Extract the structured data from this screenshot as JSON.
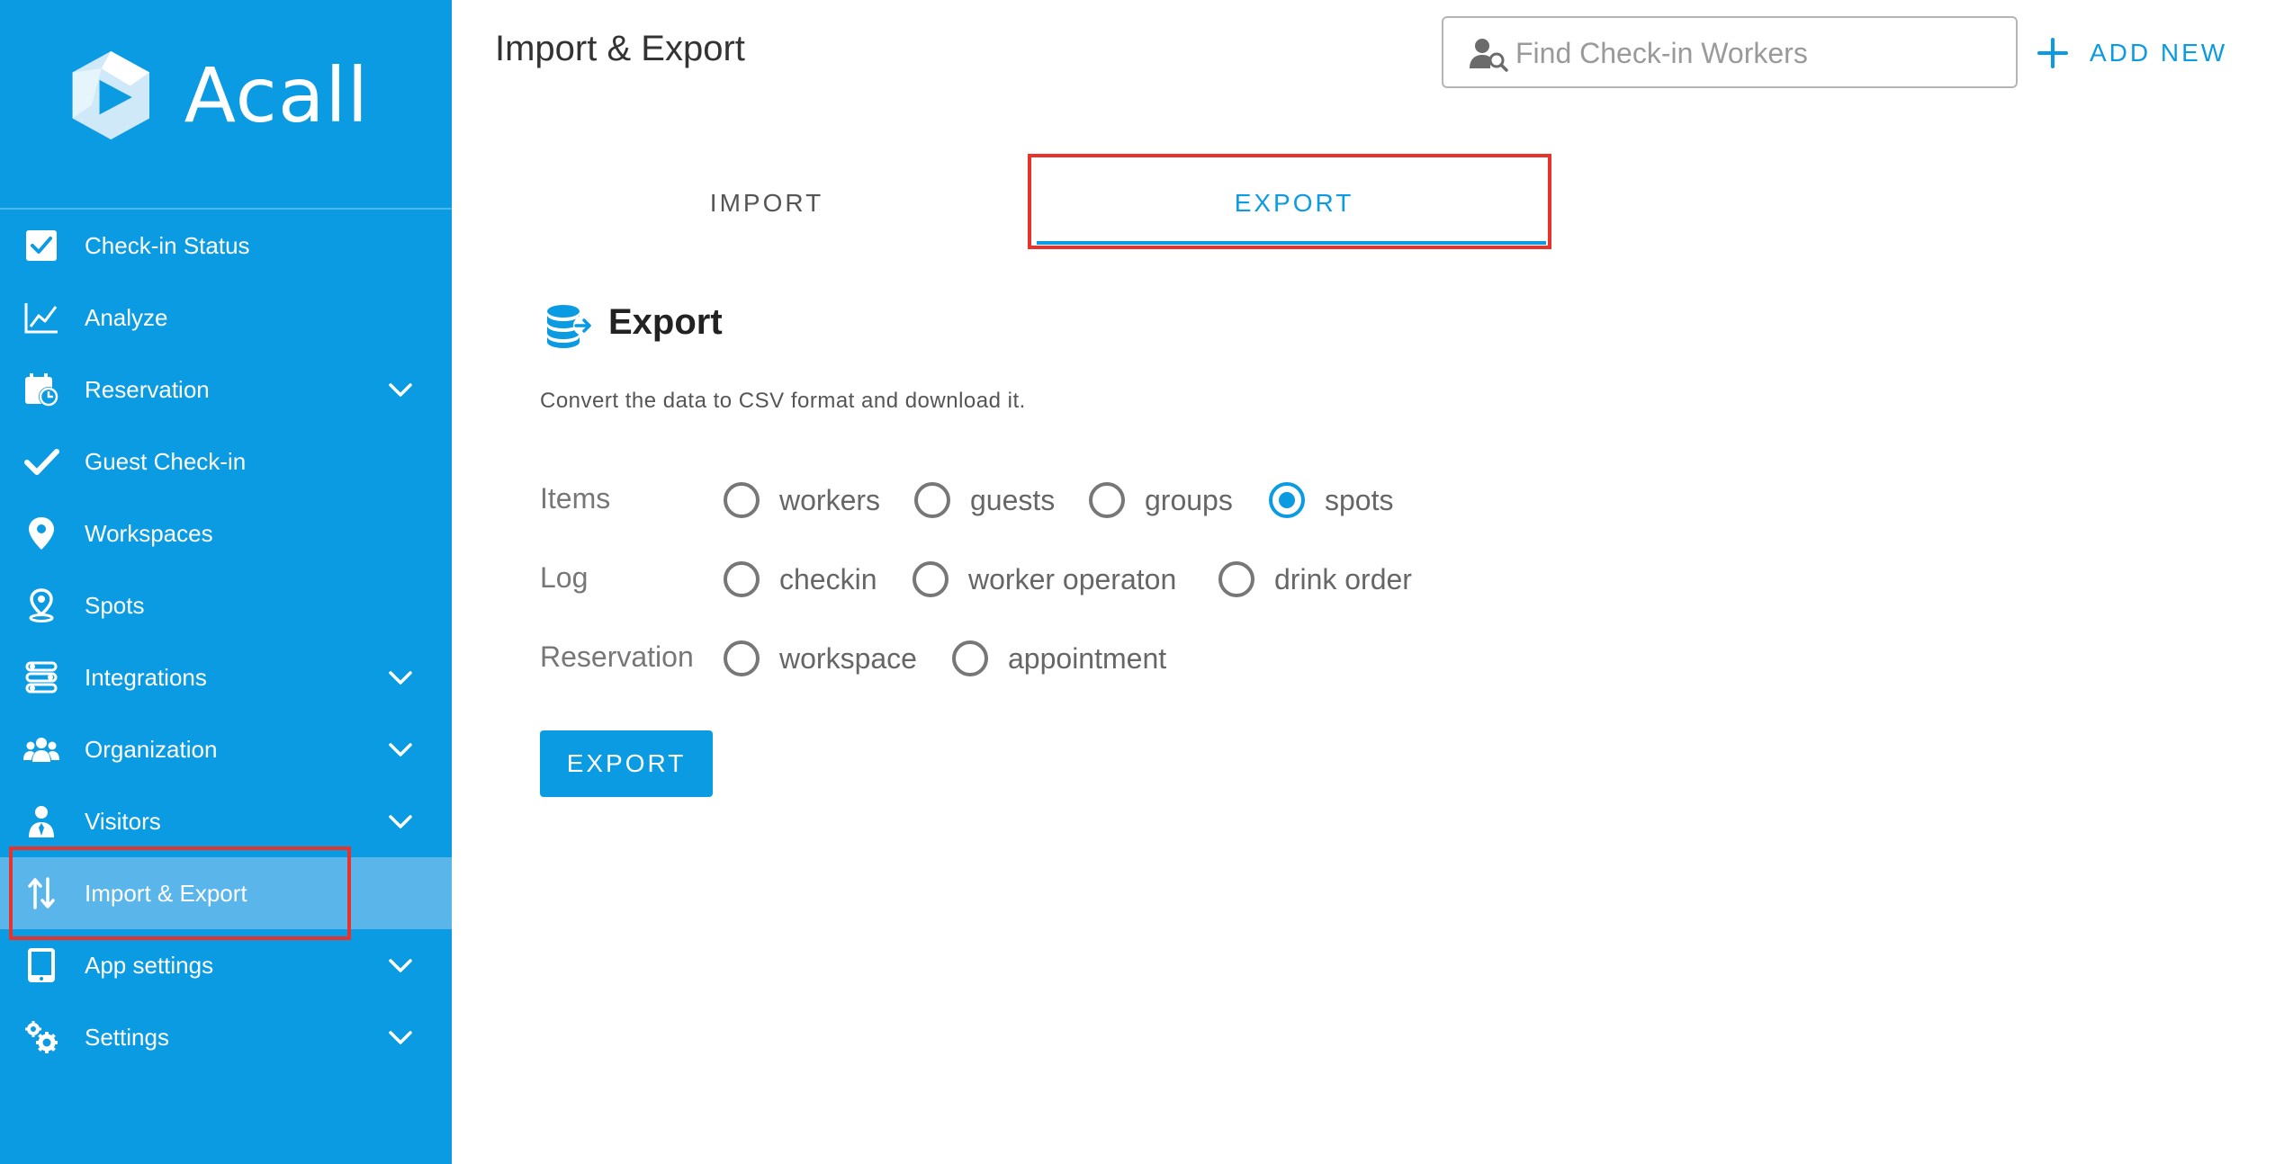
{
  "app": {
    "name": "Acall",
    "page_title": "Import & Export"
  },
  "colors": {
    "accent": "#0a9be2",
    "active_nav": "#59b5ea",
    "highlight_box": "#e8322c"
  },
  "search": {
    "placeholder": "Find Check-in Workers",
    "value": ""
  },
  "header": {
    "add_new_label": "ADD NEW"
  },
  "sidebar": {
    "items": [
      {
        "label": "Check-in Status",
        "icon": "checkbox-icon",
        "has_submenu": false,
        "active": false
      },
      {
        "label": "Analyze",
        "icon": "line-chart-icon",
        "has_submenu": false,
        "active": false
      },
      {
        "label": "Reservation",
        "icon": "calendar-clock-icon",
        "has_submenu": true,
        "active": false
      },
      {
        "label": "Guest Check-in",
        "icon": "checkmark-icon",
        "has_submenu": false,
        "active": false
      },
      {
        "label": "Workspaces",
        "icon": "map-pin-icon",
        "has_submenu": false,
        "active": false
      },
      {
        "label": "Spots",
        "icon": "location-pin-icon",
        "has_submenu": false,
        "active": false
      },
      {
        "label": "Integrations",
        "icon": "integrations-icon",
        "has_submenu": true,
        "active": false
      },
      {
        "label": "Organization",
        "icon": "people-icon",
        "has_submenu": true,
        "active": false
      },
      {
        "label": "Visitors",
        "icon": "visitor-icon",
        "has_submenu": true,
        "active": false
      },
      {
        "label": "Import & Export",
        "icon": "import-export-icon",
        "has_submenu": false,
        "active": true
      },
      {
        "label": "App settings",
        "icon": "tablet-icon",
        "has_submenu": true,
        "active": false
      },
      {
        "label": "Settings",
        "icon": "gears-icon",
        "has_submenu": true,
        "active": false
      }
    ]
  },
  "tabs": [
    {
      "label": "IMPORT",
      "active": false
    },
    {
      "label": "EXPORT",
      "active": true
    }
  ],
  "export_section": {
    "title": "Export",
    "description": "Convert the data to CSV format and download it.",
    "groups": [
      {
        "label": "Items",
        "options": [
          {
            "label": "workers",
            "checked": false
          },
          {
            "label": "guests",
            "checked": false
          },
          {
            "label": "groups",
            "checked": false
          },
          {
            "label": "spots",
            "checked": true
          }
        ]
      },
      {
        "label": "Log",
        "options": [
          {
            "label": "checkin",
            "checked": false
          },
          {
            "label": "worker operaton",
            "checked": false
          },
          {
            "label": "drink order",
            "checked": false
          }
        ]
      },
      {
        "label": "Reservation",
        "options": [
          {
            "label": "workspace",
            "checked": false
          },
          {
            "label": "appointment",
            "checked": false
          }
        ]
      }
    ],
    "button_label": "EXPORT"
  }
}
